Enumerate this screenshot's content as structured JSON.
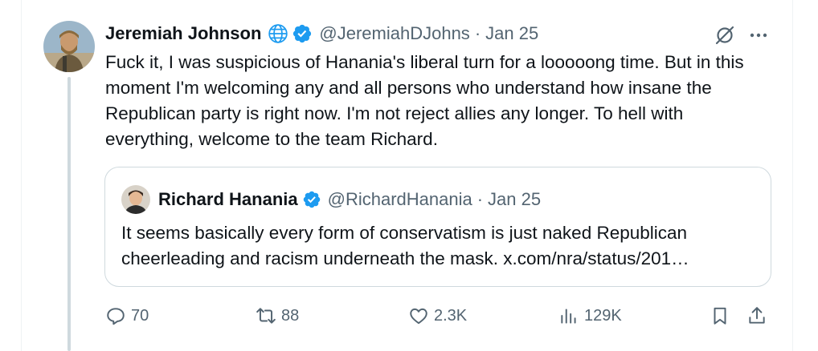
{
  "tweet": {
    "author_name": "Jeremiah Johnson",
    "handle": "@JeremiahDJohns",
    "separator": "·",
    "date": "Jan 25",
    "text": "Fuck it, I was suspicious of Hanania's liberal turn for a looooong time. But in this moment I'm welcoming any and all persons who understand how insane the Republican party is right now. I'm not reject allies any longer. To hell with everything, welcome to the team Richard.",
    "icons": [
      "globe-icon",
      "verified-badge-icon",
      "grok-icon",
      "more-icon"
    ]
  },
  "quote": {
    "author_name": "Richard Hanania",
    "handle": "@RichardHanania",
    "separator": "·",
    "date": "Jan 25",
    "text": "It seems basically every form of conservatism is just naked Republican cheerleading and racism underneath the mask. x.com/nra/status/201…"
  },
  "actions": {
    "replies": "70",
    "reposts": "88",
    "likes": "2.3K",
    "views": "129K"
  },
  "colors": {
    "verified": "#1d9bf0",
    "secondary_text": "#536471",
    "border": "#cfd9de"
  }
}
